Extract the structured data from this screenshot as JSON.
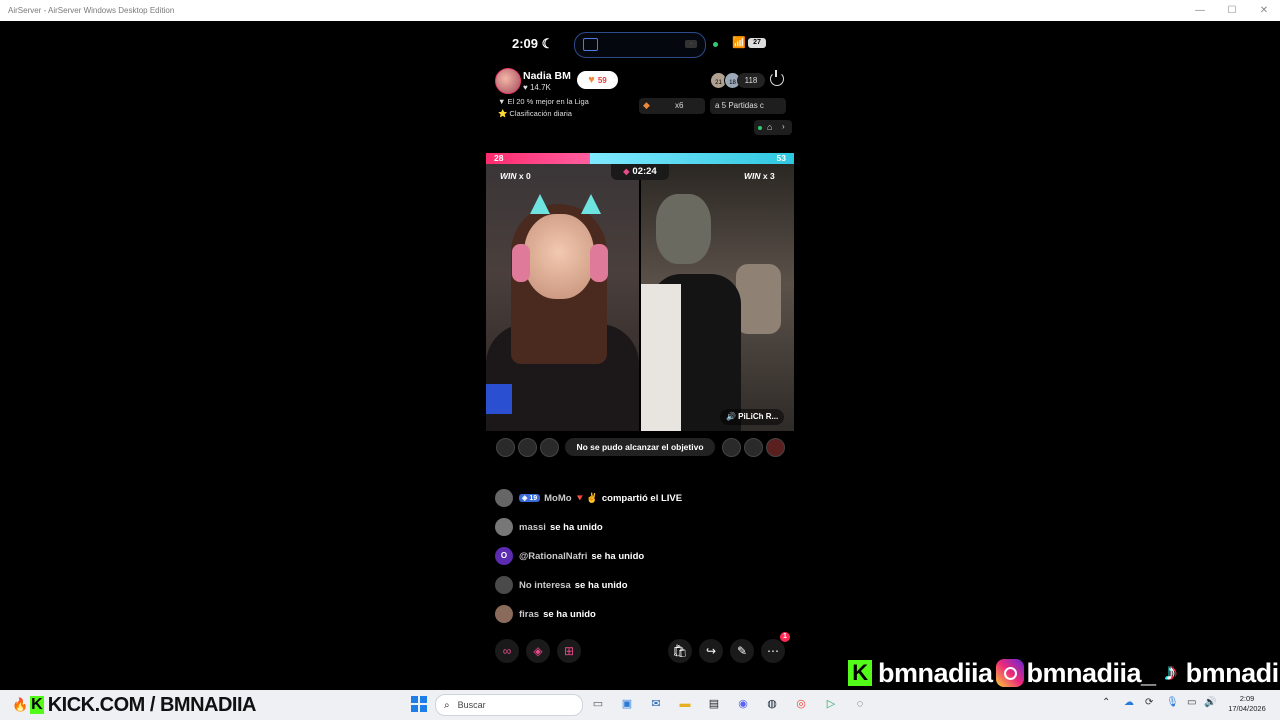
{
  "window": {
    "title": "AirServer - AirServer Windows Desktop Edition",
    "controls": [
      "—",
      "☐",
      "✕"
    ]
  },
  "status_bar": {
    "time": "2:09",
    "battery": "27"
  },
  "host": {
    "name": "Nadia BM",
    "likes": "♥ 14.7K",
    "follow_count": "59"
  },
  "viewer_count": "118",
  "viewer_badges": [
    "21",
    "18"
  ],
  "ranking": {
    "line1": "▼ El 20 % mejor en la Liga",
    "line2": "⭐ Clasificación diaria"
  },
  "gift": {
    "multiplier": "x6"
  },
  "games": {
    "label": "a 5 Partidas c"
  },
  "battle": {
    "score_left": "28",
    "score_right": "53",
    "timer": "02:24",
    "left_win": "WIN",
    "left_win_count": "x 0",
    "right_win": "WIN",
    "right_win_count": "x 3",
    "opponent_name": "🔊 PiLiCh R...",
    "objective_text": "No se pudo alcanzar el objetivo"
  },
  "comments": [
    {
      "badge": "◈ 19",
      "user": "MoMo 🔻✌",
      "text": "compartió el LIVE",
      "avatar_color": "#666666"
    },
    {
      "badge": "",
      "user": "massi",
      "text": "se ha unido",
      "avatar_color": "#777777"
    },
    {
      "badge": "",
      "user": "@RationalNafri",
      "text": "se ha unido",
      "avatar_color": "#5b2bb0",
      "initial": "O"
    },
    {
      "badge": "",
      "user": "No interesa",
      "text": "se ha unido",
      "avatar_color": "#4a4a4a"
    },
    {
      "badge": "",
      "user": "firas",
      "text": "se ha unido",
      "avatar_color": "#8a6a5a"
    }
  ],
  "bottom_bar": {
    "notification_count": "1"
  },
  "branding": {
    "handle1": "bmnadiia",
    "handle2": "bmnadiia_",
    "handle3": "bmnadiia",
    "kick_url": "KICK.COM / BMNADIIA"
  },
  "taskbar": {
    "search_placeholder": "Buscar",
    "clock_time": "2:09",
    "clock_date": "17/04/2026"
  },
  "colors": {
    "battle_pink": "#ff2b6e",
    "battle_cyan": "#2ec7e0",
    "kick_green": "#53fc18",
    "taskbar_bg": "#eef0f4"
  }
}
